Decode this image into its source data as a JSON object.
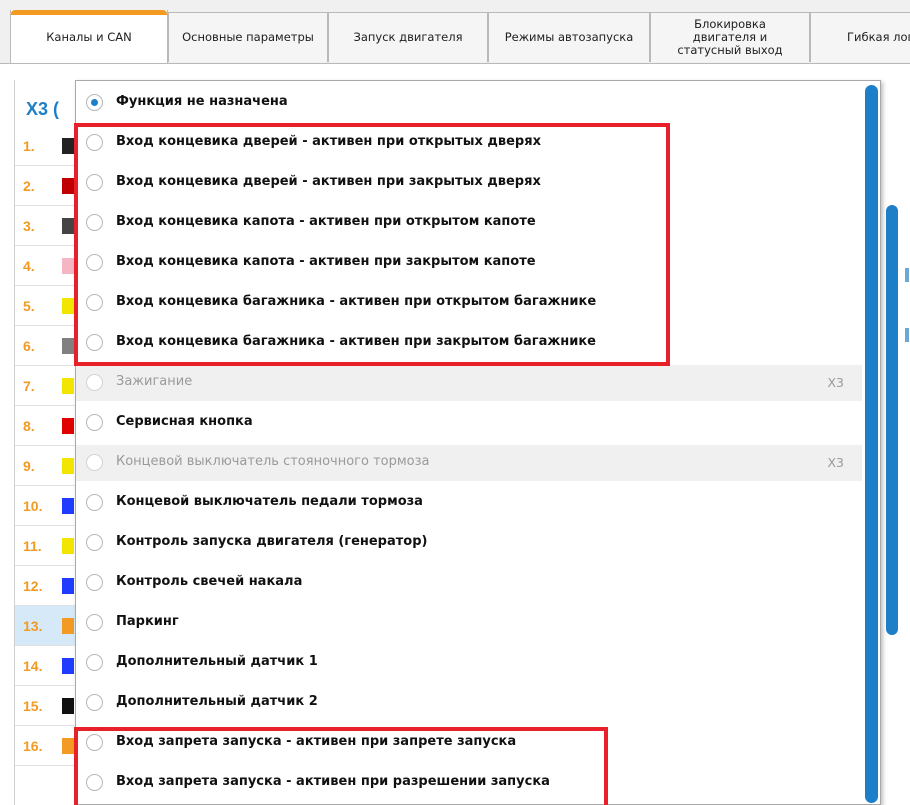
{
  "tabs": [
    {
      "label": "Каналы и CAN",
      "active": true
    },
    {
      "label": "Основные параметры",
      "active": false
    },
    {
      "label": "Запуск двигателя",
      "active": false
    },
    {
      "label": "Режимы автозапуска",
      "active": false
    },
    {
      "label": "Блокировка двигателя и статусный выход",
      "active": false
    },
    {
      "label": "Гибкая логика",
      "active": false
    }
  ],
  "panel": {
    "header": "X3 (",
    "channels": [
      {
        "num": "1.",
        "color": "#222222"
      },
      {
        "num": "2.",
        "color": "#c00000"
      },
      {
        "num": "3.",
        "color": "#444444"
      },
      {
        "num": "4.",
        "color": "#f4b6c2"
      },
      {
        "num": "5.",
        "color": "#f2e600"
      },
      {
        "num": "6.",
        "color": "#808080"
      },
      {
        "num": "7.",
        "color": "#f2e600"
      },
      {
        "num": "8.",
        "color": "#e00000"
      },
      {
        "num": "9.",
        "color": "#f2e600"
      },
      {
        "num": "10.",
        "color": "#1f3cff"
      },
      {
        "num": "11.",
        "color": "#f2e600"
      },
      {
        "num": "12.",
        "color": "#1f3cff"
      },
      {
        "num": "13.",
        "color": "#f39a22"
      },
      {
        "num": "14.",
        "color": "#1f3cff"
      },
      {
        "num": "15.",
        "color": "#111111"
      },
      {
        "num": "16.",
        "color": "#f39a22"
      }
    ]
  },
  "dropdown": {
    "options": [
      {
        "label": "Функция не назначена",
        "checked": true,
        "disabled": false
      },
      {
        "label": "Вход концевика дверей - активен при открытых дверях",
        "checked": false,
        "disabled": false
      },
      {
        "label": "Вход концевика дверей - активен при закрытых дверях",
        "checked": false,
        "disabled": false
      },
      {
        "label": "Вход концевика капота - активен при открытом капоте",
        "checked": false,
        "disabled": false
      },
      {
        "label": "Вход концевика капота - активен при закрытом капоте",
        "checked": false,
        "disabled": false
      },
      {
        "label": "Вход концевика багажника - активен при открытом багажнике",
        "checked": false,
        "disabled": false
      },
      {
        "label": "Вход концевика багажника - активен при закрытом багажнике",
        "checked": false,
        "disabled": false
      },
      {
        "label": "Зажигание",
        "checked": false,
        "disabled": true,
        "tag": "X3"
      },
      {
        "label": "Сервисная кнопка",
        "checked": false,
        "disabled": false
      },
      {
        "label": "Концевой выключатель стояночного тормоза",
        "checked": false,
        "disabled": true,
        "tag": "X3"
      },
      {
        "label": "Концевой выключатель педали тормоза",
        "checked": false,
        "disabled": false
      },
      {
        "label": "Контроль запуска двигателя (генератор)",
        "checked": false,
        "disabled": false
      },
      {
        "label": "Контроль свечей накала",
        "checked": false,
        "disabled": false
      },
      {
        "label": "Паркинг",
        "checked": false,
        "disabled": false
      },
      {
        "label": "Дополнительный датчик 1",
        "checked": false,
        "disabled": false
      },
      {
        "label": "Дополнительный датчик 2",
        "checked": false,
        "disabled": false
      },
      {
        "label": "Вход запрета запуска - активен при запрете запуска",
        "checked": false,
        "disabled": false
      },
      {
        "label": "Вход запрета запуска - активен при разрешении запуска",
        "checked": false,
        "disabled": false
      }
    ]
  },
  "colors": {
    "accent": "#1e7fc8",
    "tab_active": "#f39a22",
    "highlight": "#e8202a",
    "channel_number": "#f39a22"
  }
}
